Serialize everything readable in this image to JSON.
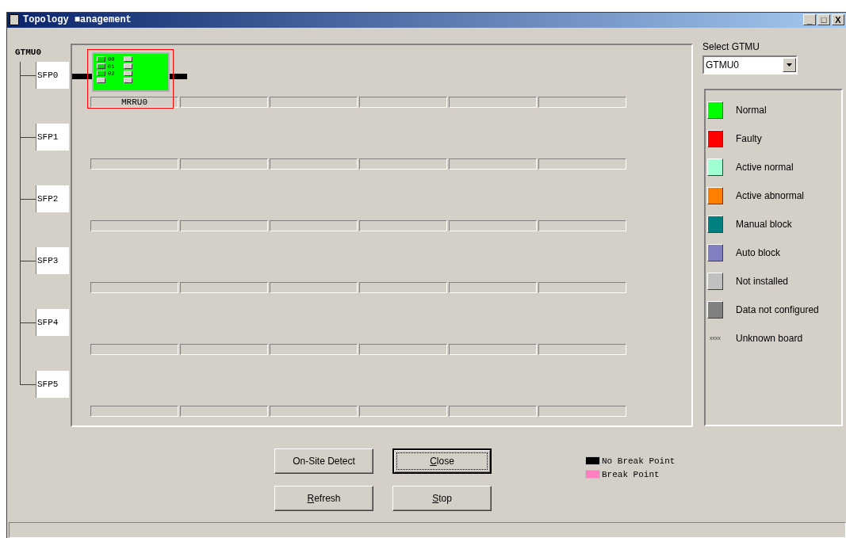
{
  "window": {
    "title": "Topology ■anagement",
    "controls": [
      "_",
      "□",
      "X"
    ]
  },
  "topology": {
    "root": "GTMU0",
    "ports": [
      {
        "name": "SFP0",
        "link_break": false,
        "slots": [
          {
            "kind": "board",
            "label": "MRRU0",
            "color": "#00ff00",
            "selected": true,
            "ports": [
              "00",
              "01",
              "02"
            ]
          },
          {
            "kind": "empty"
          },
          {
            "kind": "empty"
          },
          {
            "kind": "empty"
          },
          {
            "kind": "empty"
          },
          {
            "kind": "empty"
          }
        ]
      },
      {
        "name": "SFP1",
        "slots": [
          {
            "kind": "empty"
          },
          {
            "kind": "empty"
          },
          {
            "kind": "empty"
          },
          {
            "kind": "empty"
          },
          {
            "kind": "empty"
          },
          {
            "kind": "empty"
          }
        ]
      },
      {
        "name": "SFP2",
        "slots": [
          {
            "kind": "empty"
          },
          {
            "kind": "empty"
          },
          {
            "kind": "empty"
          },
          {
            "kind": "empty"
          },
          {
            "kind": "empty"
          },
          {
            "kind": "empty"
          }
        ]
      },
      {
        "name": "SFP3",
        "slots": [
          {
            "kind": "empty"
          },
          {
            "kind": "empty"
          },
          {
            "kind": "empty"
          },
          {
            "kind": "empty"
          },
          {
            "kind": "empty"
          },
          {
            "kind": "empty"
          }
        ]
      },
      {
        "name": "SFP4",
        "slots": [
          {
            "kind": "empty"
          },
          {
            "kind": "empty"
          },
          {
            "kind": "empty"
          },
          {
            "kind": "empty"
          },
          {
            "kind": "empty"
          },
          {
            "kind": "empty"
          }
        ]
      },
      {
        "name": "SFP5",
        "slots": [
          {
            "kind": "empty"
          },
          {
            "kind": "empty"
          },
          {
            "kind": "empty"
          },
          {
            "kind": "empty"
          },
          {
            "kind": "empty"
          },
          {
            "kind": "empty"
          }
        ]
      }
    ]
  },
  "select_gtmu": {
    "label": "Select GTMU",
    "value": "GTMU0"
  },
  "legend": [
    {
      "kind": "swatch",
      "label": "Normal",
      "color": "#00ff00"
    },
    {
      "kind": "swatch",
      "label": "Faulty",
      "color": "#ff0000"
    },
    {
      "kind": "swatch",
      "label": "Active normal",
      "color": "#a0ffd0"
    },
    {
      "kind": "swatch",
      "label": "Active abnormal",
      "color": "#ff8000"
    },
    {
      "kind": "swatch",
      "label": "Manual block",
      "color": "#008080"
    },
    {
      "kind": "swatch",
      "label": "Auto block",
      "color": "#8080c0"
    },
    {
      "kind": "swatch",
      "label": "Not installed",
      "color": "#c0c0c0"
    },
    {
      "kind": "swatch",
      "label": "Data not configured",
      "color": "#808080"
    },
    {
      "kind": "mark",
      "mark": "xxxx",
      "label": "Unknown board"
    }
  ],
  "buttons": [
    {
      "label": "On-Site Detect",
      "underline_first": false,
      "default": false
    },
    {
      "label": "Close",
      "underline_first": true,
      "default": true
    },
    {
      "label": "Refresh",
      "underline_first": true,
      "default": false
    },
    {
      "label": "Stop",
      "underline_first": true,
      "default": false
    }
  ],
  "break_legend": [
    {
      "label": "No Break Point",
      "color": "#000000"
    },
    {
      "label": "Break Point",
      "color": "#ff80c0"
    }
  ]
}
